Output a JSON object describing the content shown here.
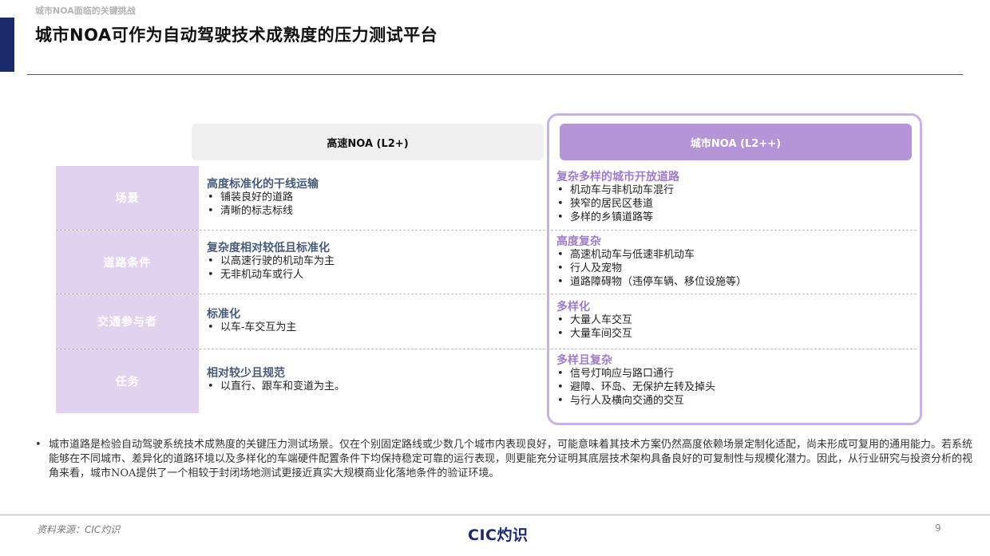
{
  "header": {
    "breadcrumb": "城市NOA面临的关键挑战",
    "title": "城市NOA可作为自动驾驶技术成熟度的压力测试平台"
  },
  "columns": {
    "highway": "高速NOA (L2+)",
    "city": "城市NOA (L2++)"
  },
  "rows": [
    {
      "label": "场景",
      "highway": {
        "title": "高度标准化的干线运输",
        "items": [
          "铺装良好的道路",
          "清晰的标志标线"
        ]
      },
      "city": {
        "title": "复杂多样的城市开放道路",
        "items": [
          "机动车与非机动车混行",
          "狭窄的居民区巷道",
          "多样的乡镇道路等"
        ]
      }
    },
    {
      "label": "道路条件",
      "highway": {
        "title": "复杂度相对较低且标准化",
        "items": [
          "以高速行驶的机动车为主",
          "无非机动车或行人"
        ]
      },
      "city": {
        "title": "高度复杂",
        "items": [
          "高速机动车与低速非机动车",
          "行人及宠物",
          "道路障碍物（违停车辆、移位设施等）"
        ]
      }
    },
    {
      "label": "交通参与者",
      "highway": {
        "title": "标准化",
        "items": [
          "以车-车交互为主"
        ]
      },
      "city": {
        "title": "多样化",
        "items": [
          "大量人车交互",
          "大量车间交互"
        ]
      }
    },
    {
      "label": "任务",
      "highway": {
        "title": "相对较少且规范",
        "items": [
          "以直行、跟车和变道为主。"
        ]
      },
      "city": {
        "title": "多样且复杂",
        "items": [
          "信号灯响应与路口通行",
          "避障、环岛、无保护左转及掉头",
          "与行人及横向交通的交互"
        ]
      }
    }
  ],
  "note": "城市道路是检验自动驾驶系统技术成熟度的关键压力测试场景。仅在个别固定路线或少数几个城市内表现良好，可能意味着其技术方案仍然高度依赖场景定制化适配，尚未形成可复用的通用能力。若系统能够在不同城市、差异化的道路环境以及多样化的车端硬件配置条件下均保持稳定可靠的运行表现，则更能充分证明其底层技术架构具备良好的可复制性与规模化潜力。因此，从行业研究与投资分析的视角来看，城市NOA提供了一个相较于封闭场地测试更接近真实大规模商业化落地条件的验证环境。",
  "footer": {
    "source": "资料来源：CIC灼识",
    "logo": "CIC灼识",
    "page": "9"
  }
}
